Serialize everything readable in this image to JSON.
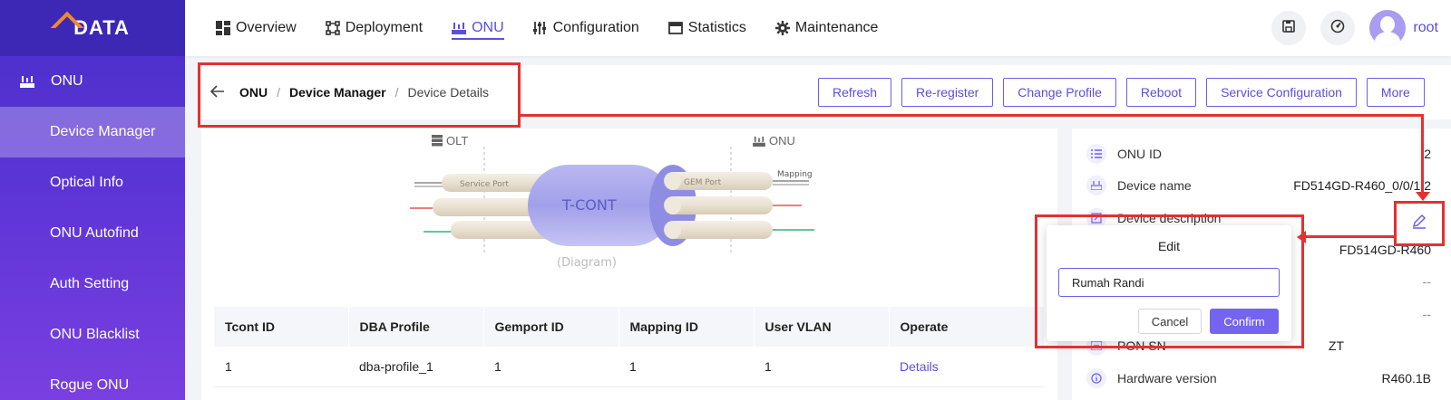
{
  "logo": {
    "text": "DATA"
  },
  "sidebar": {
    "group_label": "ONU",
    "items": [
      {
        "label": "Device Manager",
        "active": true
      },
      {
        "label": "Optical Info",
        "active": false
      },
      {
        "label": "ONU Autofind",
        "active": false
      },
      {
        "label": "Auth Setting",
        "active": false
      },
      {
        "label": "ONU Blacklist",
        "active": false
      },
      {
        "label": "Rogue ONU",
        "active": false
      }
    ]
  },
  "topnav": {
    "items": [
      {
        "label": "Overview",
        "icon": "grid-icon"
      },
      {
        "label": "Deployment",
        "icon": "deploy-icon"
      },
      {
        "label": "ONU",
        "icon": "onu-icon",
        "active": true
      },
      {
        "label": "Configuration",
        "icon": "sliders-icon"
      },
      {
        "label": "Statistics",
        "icon": "window-icon"
      },
      {
        "label": "Maintenance",
        "icon": "gear-icon"
      }
    ],
    "user": "root"
  },
  "breadcrumb": {
    "root": "ONU",
    "section": "Device Manager",
    "current": "Device Details"
  },
  "actions": [
    "Refresh",
    "Re-register",
    "Change Profile",
    "Reboot",
    "Service Configuration",
    "More"
  ],
  "diagram": {
    "olt_label": "OLT",
    "onu_label": "ONU",
    "tcont_label": "T-CONT",
    "service_port_label": "Service Port",
    "gem_port_label": "GEM Port",
    "mapping_label": "Mapping",
    "caption": "(Diagram)"
  },
  "table": {
    "headers": [
      "Tcont ID",
      "DBA Profile",
      "Gemport ID",
      "Mapping ID",
      "User VLAN",
      "Operate"
    ],
    "rows": [
      [
        "1",
        "dba-profile_1",
        "1",
        "1",
        "1",
        "Details"
      ]
    ]
  },
  "info": {
    "onu_id_label": "ONU ID",
    "onu_id_value": "2",
    "device_name_label": "Device name",
    "device_name_value": "FD514GD-R460_0/0/1:2",
    "device_desc_label": "Device description",
    "model_value": "FD514GD-R460",
    "dash1": "--",
    "dash2": "--",
    "pon_sn_label": "PON SN",
    "pon_sn_value": "ZT",
    "hw_label": "Hardware version",
    "hw_value": "R460.1B"
  },
  "popover": {
    "title": "Edit",
    "input_value": "Rumah Randi",
    "cancel_label": "Cancel",
    "confirm_label": "Confirm"
  },
  "colors": {
    "accent": "#5b4ee0",
    "highlight": "#e53030",
    "sidebar": "#5b34d6"
  }
}
